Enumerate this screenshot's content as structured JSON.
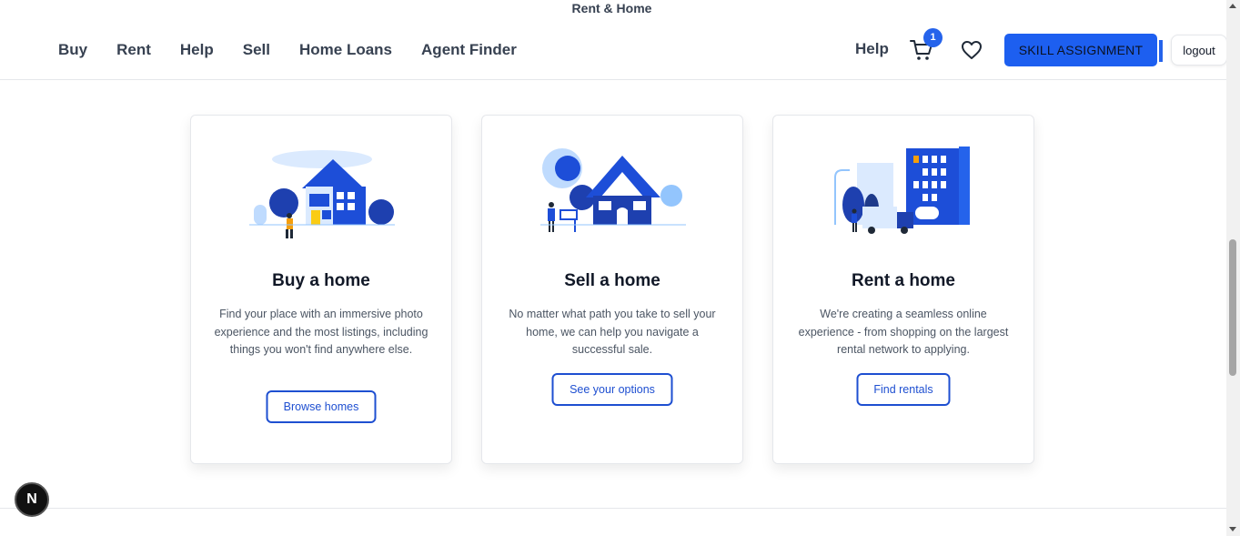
{
  "site": {
    "title": "Rent & Home"
  },
  "nav": {
    "left": [
      "Buy",
      "Rent",
      "Help",
      "Sell",
      "Home Loans",
      "Agent Finder"
    ],
    "help": "Help",
    "cart_count": "1",
    "skill_button": "SKILL ASSIGNMENT",
    "logout": "logout"
  },
  "cards": [
    {
      "title": "Buy a home",
      "description": "Find your place with an immersive photo experience and the most listings, including things you won't find anywhere else.",
      "button": "Browse homes",
      "icon": "buy-home-illustration"
    },
    {
      "title": "Sell a home",
      "description": "No matter what path you take to sell your home, we can help you navigate a successful sale.",
      "button": "See your options",
      "icon": "sell-home-illustration"
    },
    {
      "title": "Rent a home",
      "description": "We're creating a seamless online experience - from shopping on the largest rental network to applying.",
      "button": "Find rentals",
      "icon": "rent-home-illustration"
    }
  ],
  "dev_badge": "N",
  "colors": {
    "accent": "#1d5ff0",
    "button_border": "#1e4fd1",
    "text": "#374151"
  }
}
